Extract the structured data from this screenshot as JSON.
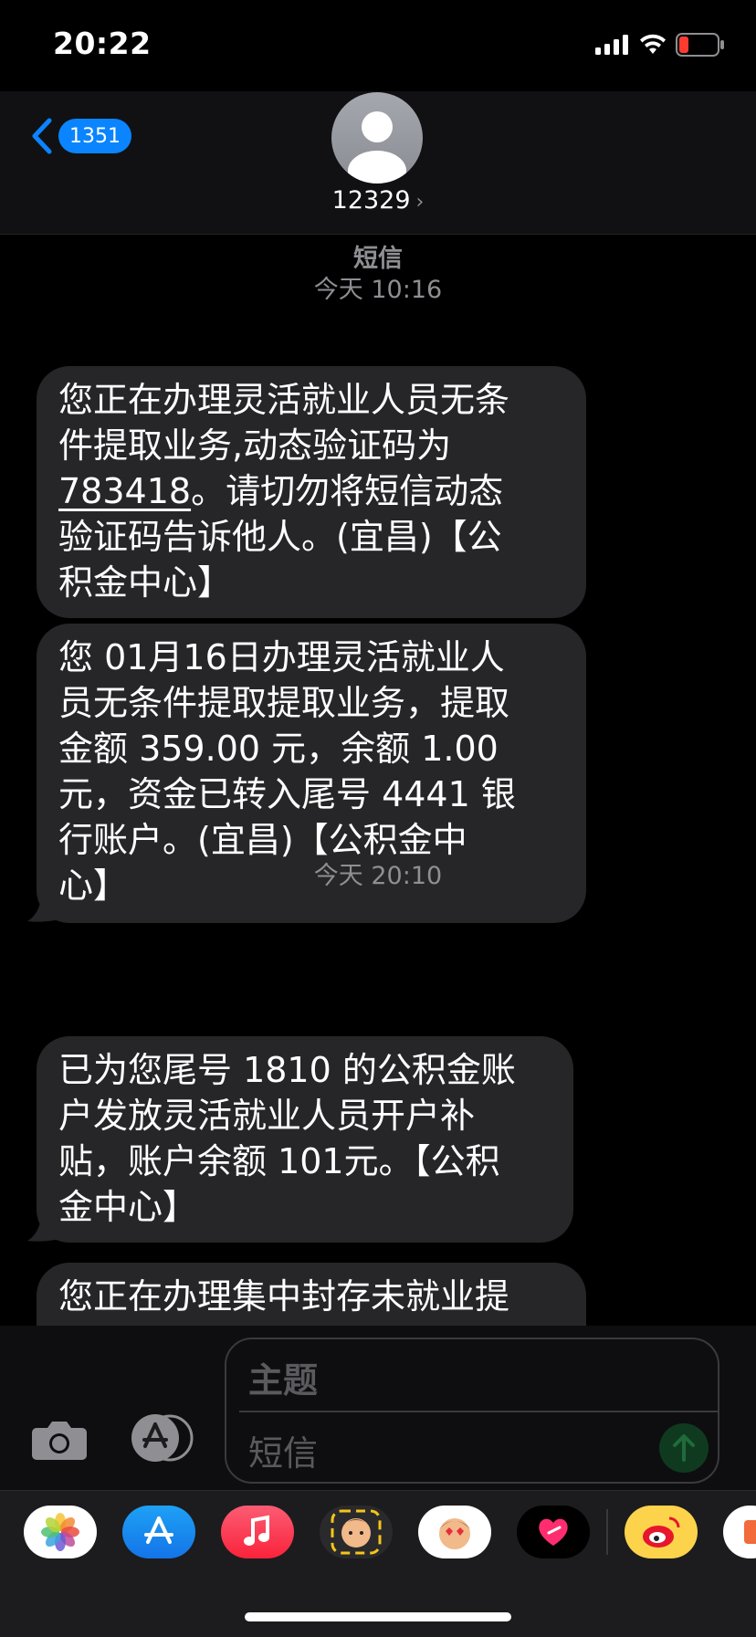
{
  "status": {
    "time": "20:22",
    "battery_color": "#ff3b30"
  },
  "header": {
    "back_badge": "1351",
    "contact_name": "12329",
    "chevron": "›",
    "avatar_icon": "person-silhouette-icon"
  },
  "conversation": {
    "service_label": "短信",
    "time_label_1": "今天 10:16",
    "time_label_2": "今天 20:10",
    "messages": [
      {
        "lines": [
          "您正在办理灵活就业人员无条",
          "件提取业务,动态验证码为",
          "。请切勿将短信动态",
          "验证码告诉他人。(宜昌)【公",
          "积金中心】"
        ],
        "code": "783418"
      },
      {
        "lines": [
          "您 01月16日办理灵活就业人",
          "员无条件提取提取业务，提取",
          "金额 359.00 元，余额 1.00",
          "元，资金已转入尾号 4441 银",
          "行账户。(宜昌)【公积金中",
          "心】"
        ]
      },
      {
        "lines": [
          "已为您尾号 1810 的公积金账",
          "户发放灵活就业人员开户补",
          "贴，账户余额 101元。【公积",
          "金中心】"
        ]
      },
      {
        "lines": [
          "您正在办理集中封存未就业提",
          ""
        ]
      }
    ]
  },
  "input": {
    "subject_placeholder": "主题",
    "body_placeholder": "短信",
    "camera_icon": "camera-icon",
    "apps_icon": "app-store-icon",
    "send_icon": "send-arrow-icon"
  },
  "drawer": {
    "apps": [
      "photos-icon",
      "app-store-icon",
      "music-icon",
      "memoji-icon",
      "memoji-stickers-icon",
      "digital-touch-icon",
      "weibo-icon",
      "more-app-icon"
    ]
  }
}
